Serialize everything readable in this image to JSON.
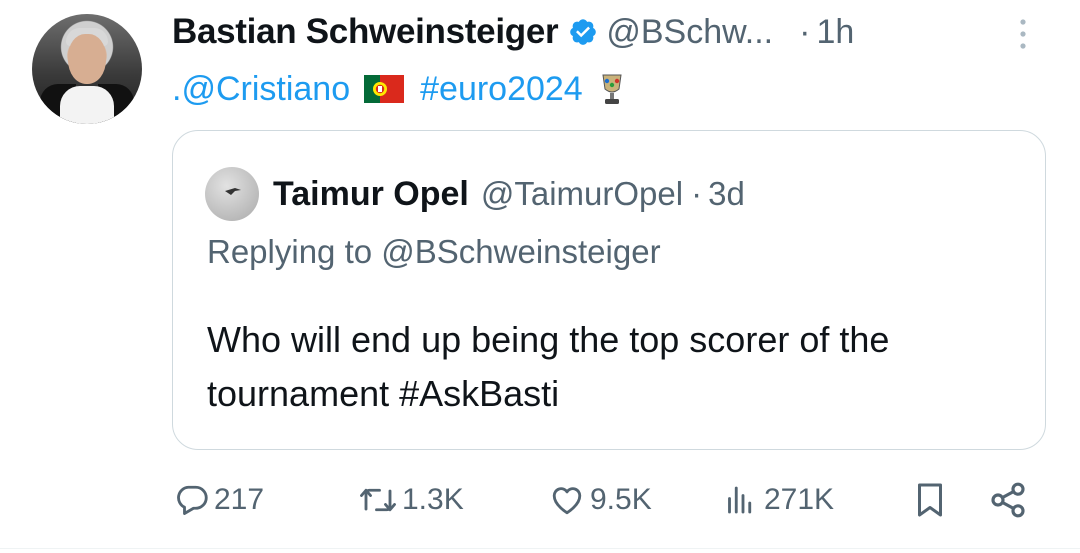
{
  "tweet": {
    "author_name": "Bastian Schweinsteiger",
    "author_handle": "@BSchw...",
    "separator": "·",
    "time": "1h",
    "mention": ".@Cristiano",
    "hashtag": "#euro2024"
  },
  "quoted": {
    "author_name": "Taimur Opel",
    "author_handle": "@TaimurOpel",
    "separator": "·",
    "time": "3d",
    "replying_to": "Replying to @BSchweinsteiger",
    "body": "Who will end up being the top scorer of the tournament #AskBasti"
  },
  "actions": {
    "replies": "217",
    "retweets": "1.3K",
    "likes": "9.5K",
    "views": "271K"
  },
  "icons": {
    "verified": "verified-badge-icon",
    "more": "more-vertical-icon",
    "flag": "portugal-flag-icon",
    "trophy": "euro-trophy-icon",
    "reply": "reply-icon",
    "retweet": "retweet-icon",
    "like": "heart-icon",
    "views": "views-icon",
    "bookmark": "bookmark-icon",
    "share": "share-icon"
  },
  "colors": {
    "link": "#1d9bf0",
    "secondary_text": "#536471",
    "primary_text": "#0f1419",
    "border": "#cfd9de"
  }
}
